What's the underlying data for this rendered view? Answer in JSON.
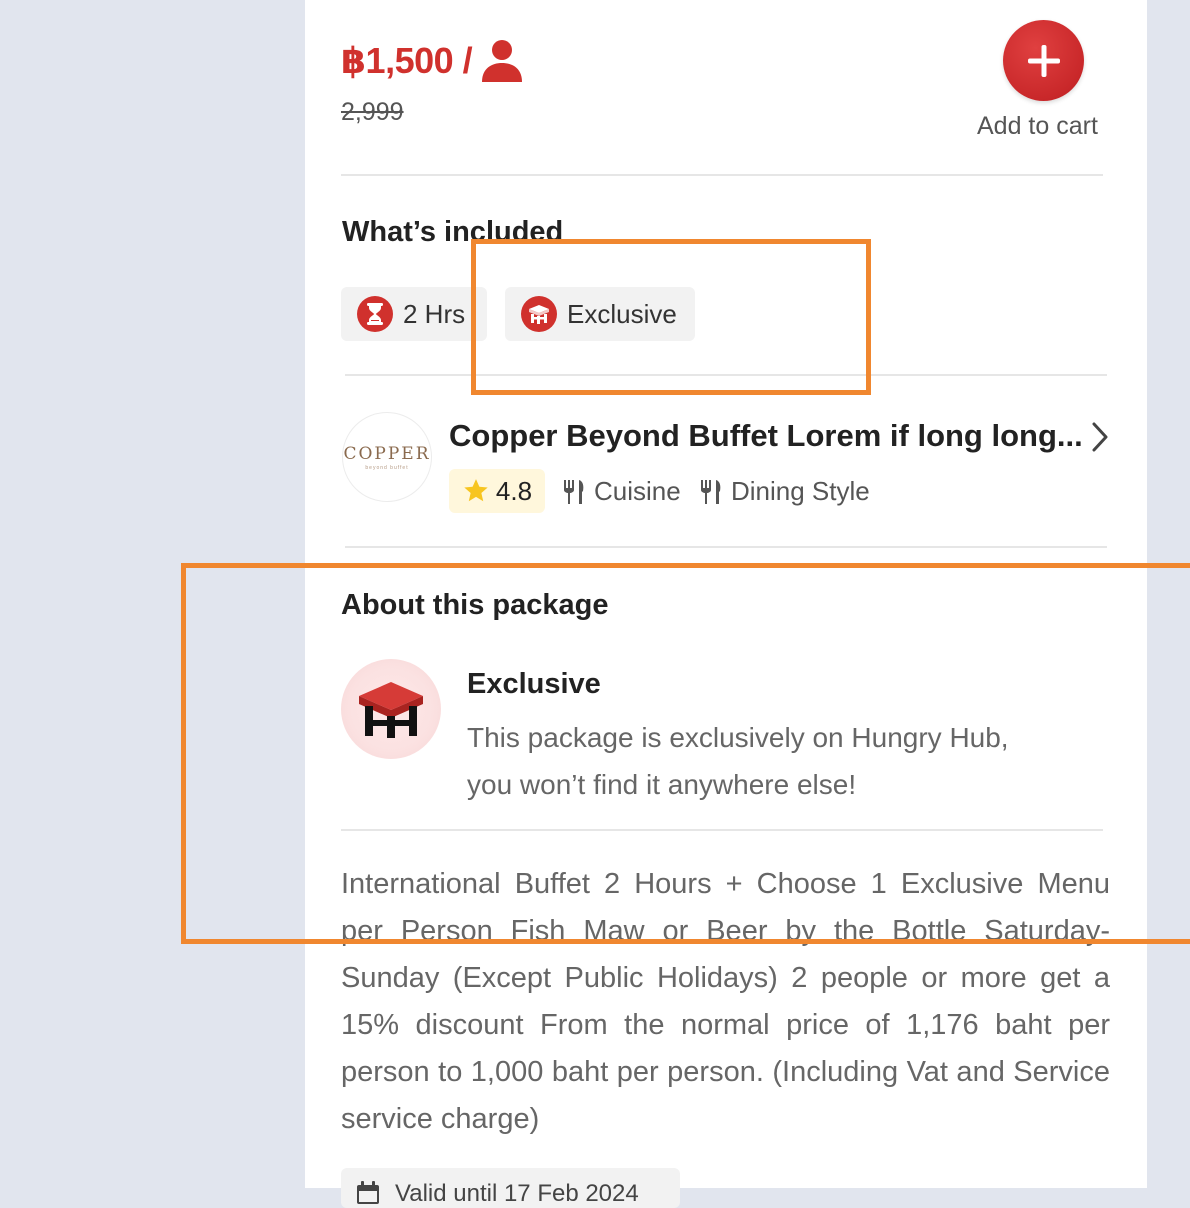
{
  "price": {
    "current": "฿1,500 /",
    "original": "2,999",
    "per_person_icon": "person-icon"
  },
  "cart": {
    "add_icon": "plus-icon",
    "label": "Add to cart"
  },
  "included": {
    "title": "What’s included",
    "chips": [
      {
        "icon": "hourglass-icon",
        "label": "2 Hrs"
      },
      {
        "icon": "exclusive-table-icon",
        "label": "Exclusive"
      }
    ]
  },
  "restaurant": {
    "logo_text": "COPPER",
    "logo_subtext": "beyond buffet",
    "name": "Copper Beyond Buffet Lorem if long long...",
    "rating": "4.8",
    "cuisine_label": "Cuisine",
    "dining_style_label": "Dining Style"
  },
  "about": {
    "title": "About this package",
    "exclusive_title": "Exclusive",
    "exclusive_desc_line1": "This package is exclusively on Hungry Hub,",
    "exclusive_desc_line2": "you won’t find it anywhere else!",
    "description": "International Buffet 2 Hours + Choose 1 Exclusive Menu per Person Fish Maw or Beer by the Bottle Saturday-Sunday (Except Public Holidays) 2 people or more get a 15% discount From the normal price of 1,176 baht per person to 1,000 baht per person. (Including Vat and Service service charge)",
    "valid_until": "Valid until 17 Feb 2024"
  },
  "colors": {
    "brand_red": "#d0312d",
    "highlight_orange": "#f0872f",
    "page_bg": "#e1e5ee"
  }
}
